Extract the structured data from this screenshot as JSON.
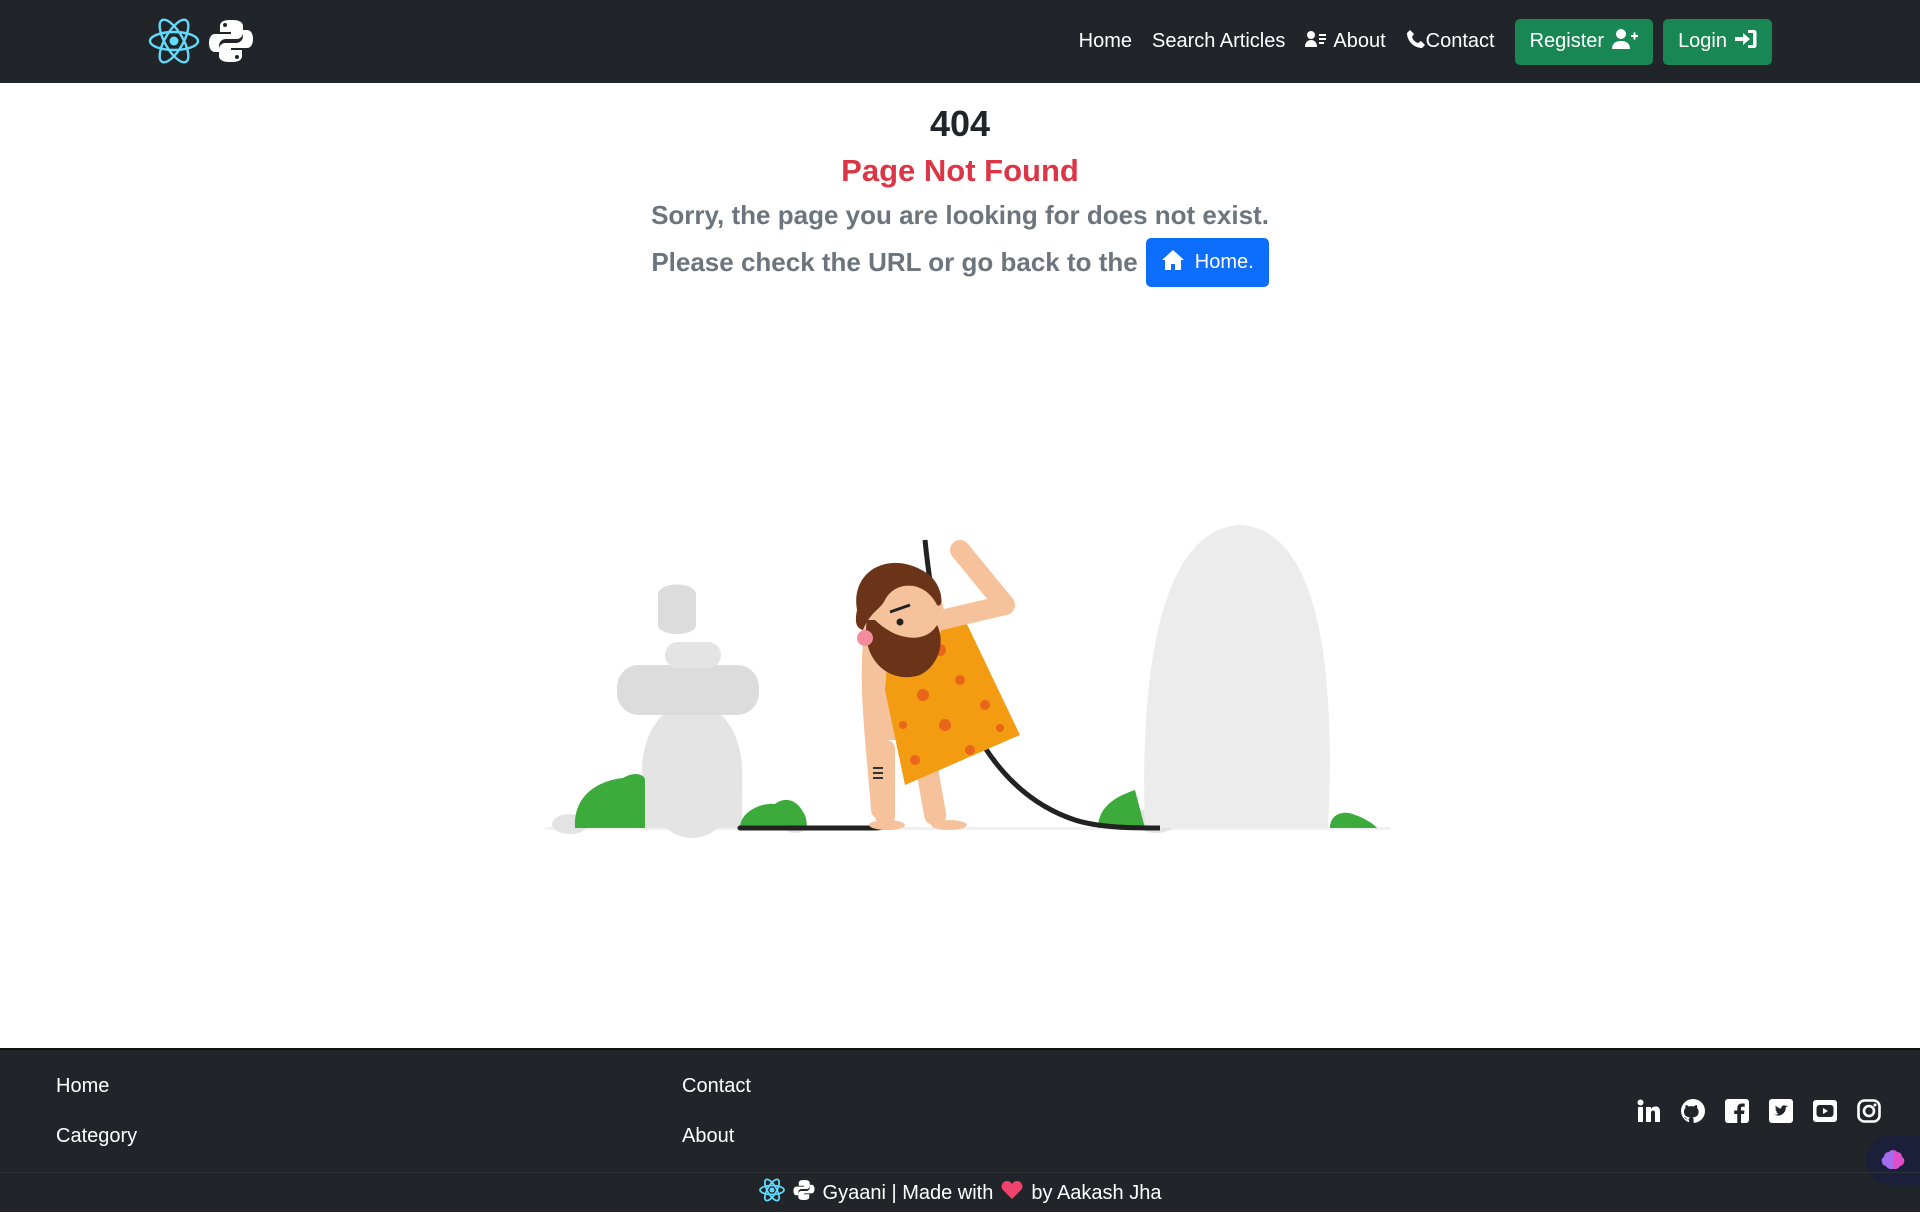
{
  "navbar": {
    "brand_icons": [
      "react-logo-icon",
      "python-logo-icon"
    ],
    "links": {
      "home": "Home",
      "search": "Search Articles",
      "about": "About",
      "contact": "Contact"
    },
    "register": "Register",
    "login": "Login"
  },
  "error": {
    "code": "404",
    "title": "Page Not Found",
    "message": "Sorry, the page you are looking for does not exist.",
    "check_text": "Please check the URL or go back to the",
    "home_button": "Home."
  },
  "footer": {
    "col1": [
      "Home",
      "Category"
    ],
    "col2": [
      "Contact",
      "About"
    ],
    "social": [
      "linkedin-icon",
      "github-icon",
      "facebook-icon",
      "twitter-icon",
      "youtube-icon",
      "instagram-icon"
    ],
    "copyright": {
      "site": "Gyaani | Made with",
      "author": "by Aakash Jha"
    }
  },
  "colors": {
    "navbar_bg": "#212529",
    "success": "#198754",
    "primary": "#0d6efd",
    "danger": "#dc3545",
    "muted": "#6c757d",
    "react": "#61dafb"
  }
}
